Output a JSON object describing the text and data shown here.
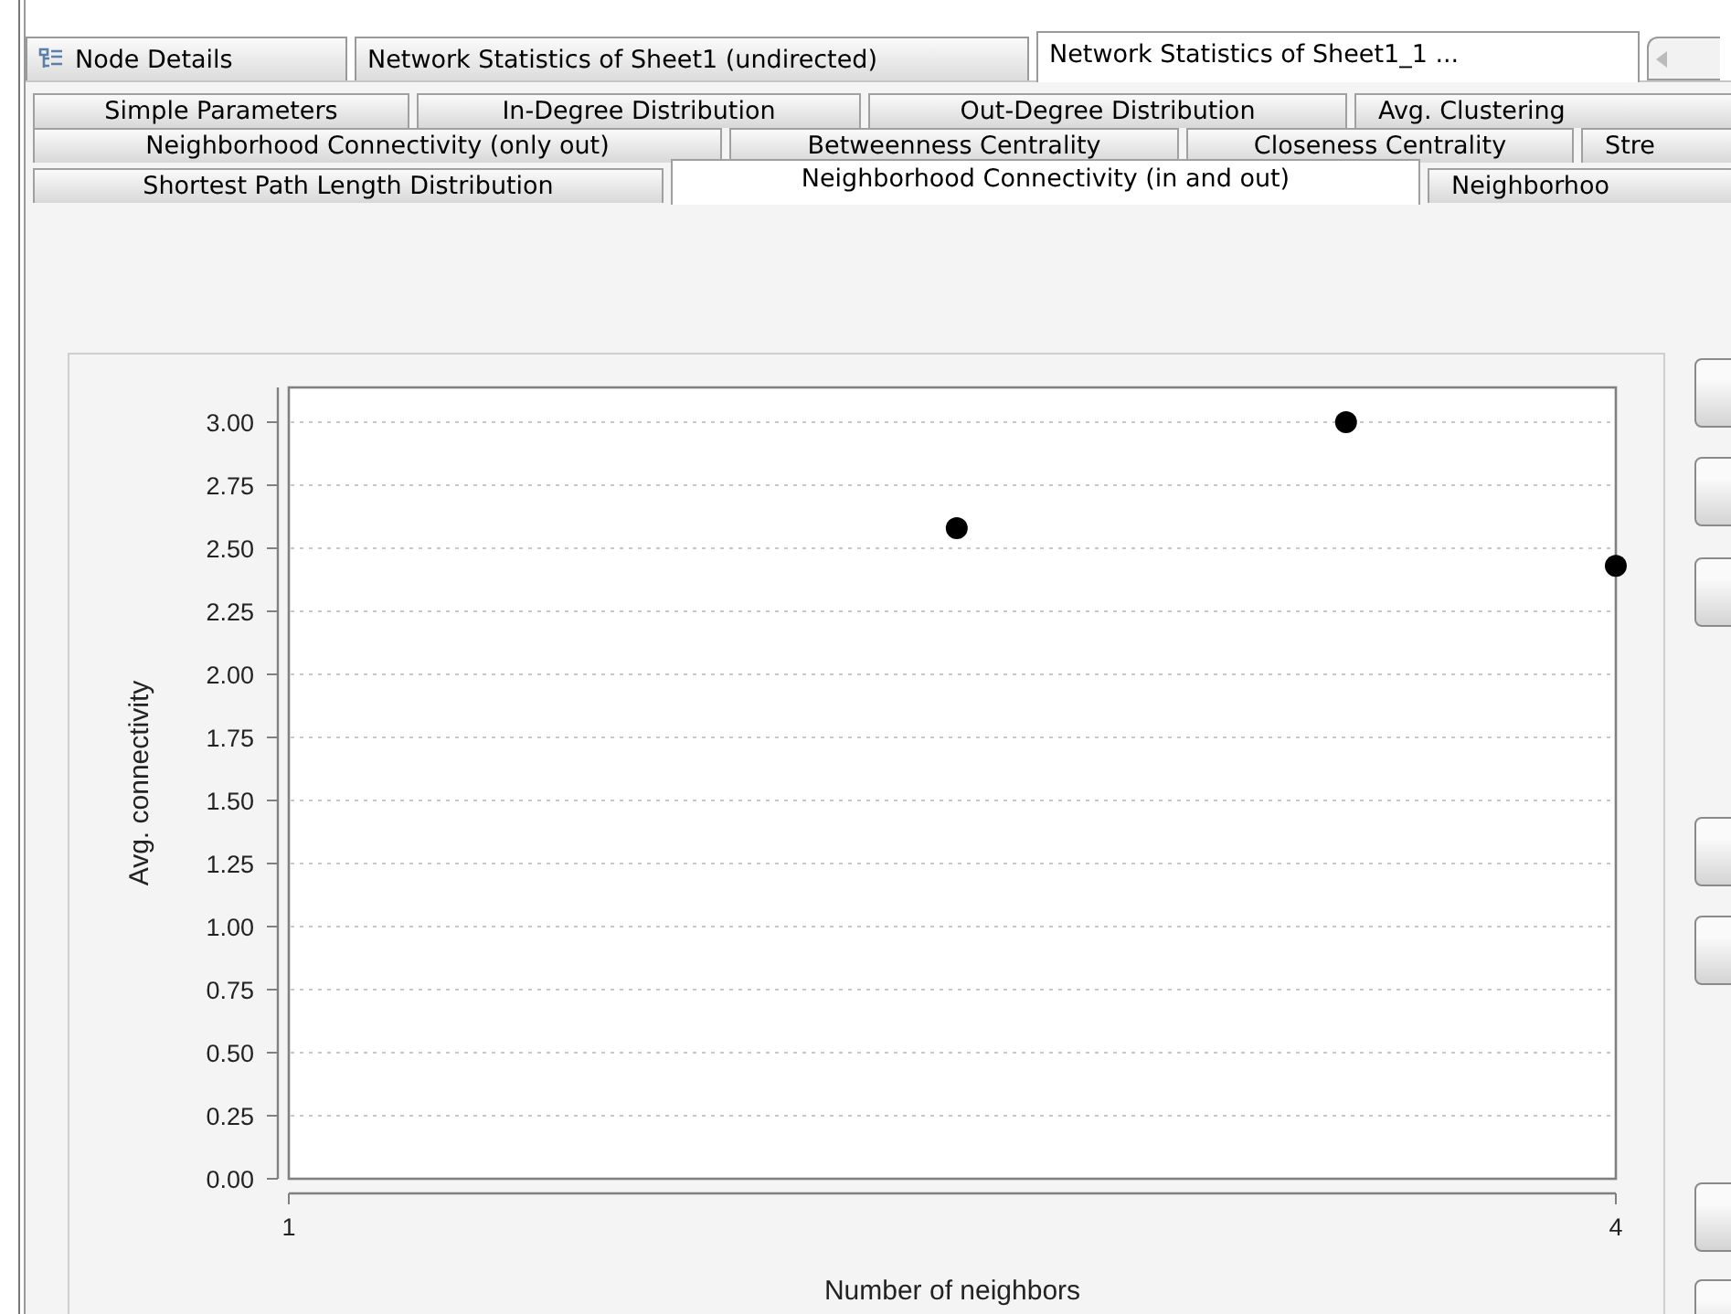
{
  "document_tabs": [
    {
      "label": "Node Details",
      "kind": "icon",
      "selected": false
    },
    {
      "label": "Network Statistics of Sheet1 (undirected)",
      "kind": "plain",
      "selected": false
    },
    {
      "label": "Network Statistics of Sheet1_1 ...",
      "kind": "plain",
      "selected": true
    }
  ],
  "statistics_tabs": [
    [
      {
        "label": "Simple Parameters",
        "selected": false
      },
      {
        "label": "In-Degree Distribution",
        "selected": false
      },
      {
        "label": "Out-Degree Distribution",
        "selected": false
      },
      {
        "label": "Avg. Clustering",
        "selected": false
      }
    ],
    [
      {
        "label": "Neighborhood Connectivity (only out)",
        "selected": false
      },
      {
        "label": "Betweenness Centrality",
        "selected": false
      },
      {
        "label": "Closeness Centrality",
        "selected": false
      },
      {
        "label": "Stre",
        "selected": false
      }
    ],
    [
      {
        "label": "Shortest Path Length Distribution",
        "selected": false
      },
      {
        "label": "Neighborhood Connectivity (in and out)",
        "selected": true
      },
      {
        "label": "Neighborhoo",
        "selected": false
      }
    ]
  ],
  "chart": {
    "chart_data": {
      "type": "scatter",
      "xlabel": "Number of neighbors",
      "ylabel": "Avg. connectivity",
      "grid": true,
      "x": [
        2.51,
        3.39,
        4
      ],
      "series": [
        {
          "color": "#000000",
          "values": [
            2.58,
            3.0,
            2.43
          ]
        }
      ],
      "xlim": [
        1,
        4
      ],
      "ylim": [
        0,
        3
      ],
      "xticks": [
        1,
        4
      ],
      "yticks": [
        {
          "value": 0,
          "label": "0.00"
        },
        {
          "value": 0.25,
          "label": "0.25"
        },
        {
          "value": 0.5,
          "label": "0.50"
        },
        {
          "value": 0.75,
          "label": "0.75"
        },
        {
          "value": 1,
          "label": "1.00"
        },
        {
          "value": 1.25,
          "label": "1.25"
        },
        {
          "value": 1.5,
          "label": "1.50"
        },
        {
          "value": 1.75,
          "label": "1.75"
        },
        {
          "value": 2,
          "label": "2.00"
        },
        {
          "value": 2.25,
          "label": "2.25"
        },
        {
          "value": 2.5,
          "label": "2.50"
        },
        {
          "value": 2.75,
          "label": "2.75"
        },
        {
          "value": 3,
          "label": "3.00"
        }
      ]
    }
  }
}
